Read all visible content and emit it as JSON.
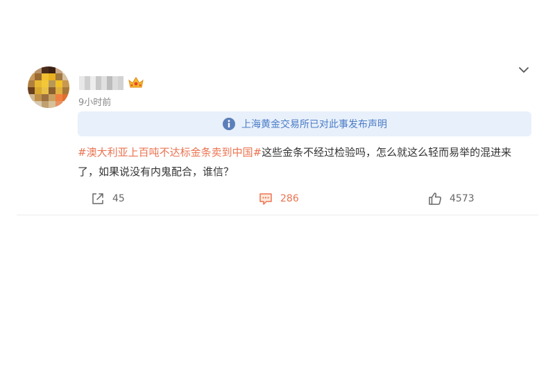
{
  "post": {
    "time": "9小时前",
    "notice": "上海黄金交易所已对此事发布声明",
    "hashtag": "#澳大利亚上百吨不达标金条卖到中国#",
    "body": "这些金条不经过检验吗，怎么就这么轻而易举的混进来了，如果说没有内鬼配合，谁信？"
  },
  "actions": {
    "share_count": "45",
    "comment_count": "286",
    "like_count": "4573"
  },
  "colors": {
    "accent": "#eb7350",
    "notice_bg": "#e8f0fb",
    "notice_text": "#4a7bc6"
  },
  "icons": {
    "more": "chevron-down-icon",
    "notice": "info-icon",
    "share": "share-icon",
    "comment": "comment-icon",
    "like": "thumbs-up-icon",
    "badge": "crown-icon"
  }
}
